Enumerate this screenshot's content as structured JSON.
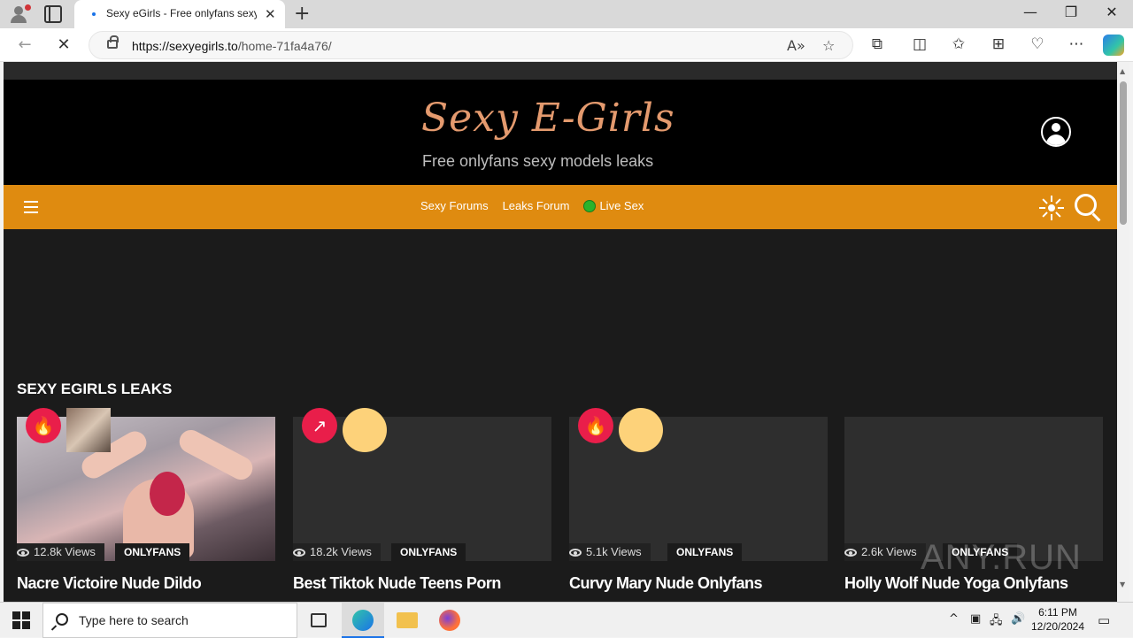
{
  "browser": {
    "tab_title": "Sexy eGirls - Free onlyfans sexy m",
    "url_host": "https://sexyegirls.to",
    "url_path": "/home-71fa4a76/"
  },
  "site": {
    "logo": "Sexy E-Girls",
    "tagline": "Free onlyfans sexy models leaks",
    "nav": {
      "forums": "Sexy Forums",
      "leaks": "Leaks Forum",
      "live": "Live Sex"
    },
    "section_title": "SEXY EGIRLS LEAKS",
    "cards": [
      {
        "views": "12.8k Views",
        "category": "ONLYFANS",
        "title": "Nacre Victoire Nude Dildo"
      },
      {
        "views": "18.2k Views",
        "category": "ONLYFANS",
        "title": "Best Tiktok Nude Teens Porn"
      },
      {
        "views": "5.1k Views",
        "category": "ONLYFANS",
        "title": "Curvy Mary Nude Onlyfans"
      },
      {
        "views": "2.6k Views",
        "category": "ONLYFANS",
        "title": "Holly Wolf Nude Yoga Onlyfans"
      }
    ]
  },
  "watermark": "ANY.RUN",
  "taskbar": {
    "search_placeholder": "Type here to search",
    "time": "6:11 PM",
    "date": "12/20/2024"
  },
  "colors": {
    "nav_bar": "#df8b10",
    "logo": "#e49a6e",
    "badge": "#e91e4a"
  }
}
